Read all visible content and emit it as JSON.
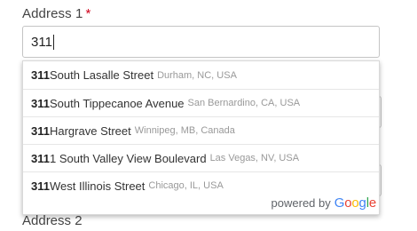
{
  "form": {
    "address1_label": "Address 1",
    "required_marker": "*",
    "address1_value": "311",
    "address2_label": "Address 2"
  },
  "suggestions": [
    {
      "match": "311",
      "rest": " South Lasalle Street",
      "secondary": "Durham, NC, USA"
    },
    {
      "match": "311",
      "rest": " South Tippecanoe Avenue",
      "secondary": "San Bernardino, CA, USA"
    },
    {
      "match": "311",
      "rest": " Hargrave Street",
      "secondary": "Winnipeg, MB, Canada"
    },
    {
      "match": "311",
      "rest": "1 South Valley View Boulevard",
      "secondary": "Las Vegas, NV, USA"
    },
    {
      "match": "311",
      "rest": " West Illinois Street",
      "secondary": "Chicago, IL, USA"
    }
  ],
  "attribution": {
    "powered_by": "powered by",
    "logo_letters": [
      "G",
      "o",
      "o",
      "g",
      "l",
      "e"
    ]
  },
  "colors": {
    "required": "#d0021b",
    "google_blue": "#4285f4",
    "google_red": "#ea4335",
    "google_yellow": "#fbbc05",
    "google_green": "#34a853"
  }
}
